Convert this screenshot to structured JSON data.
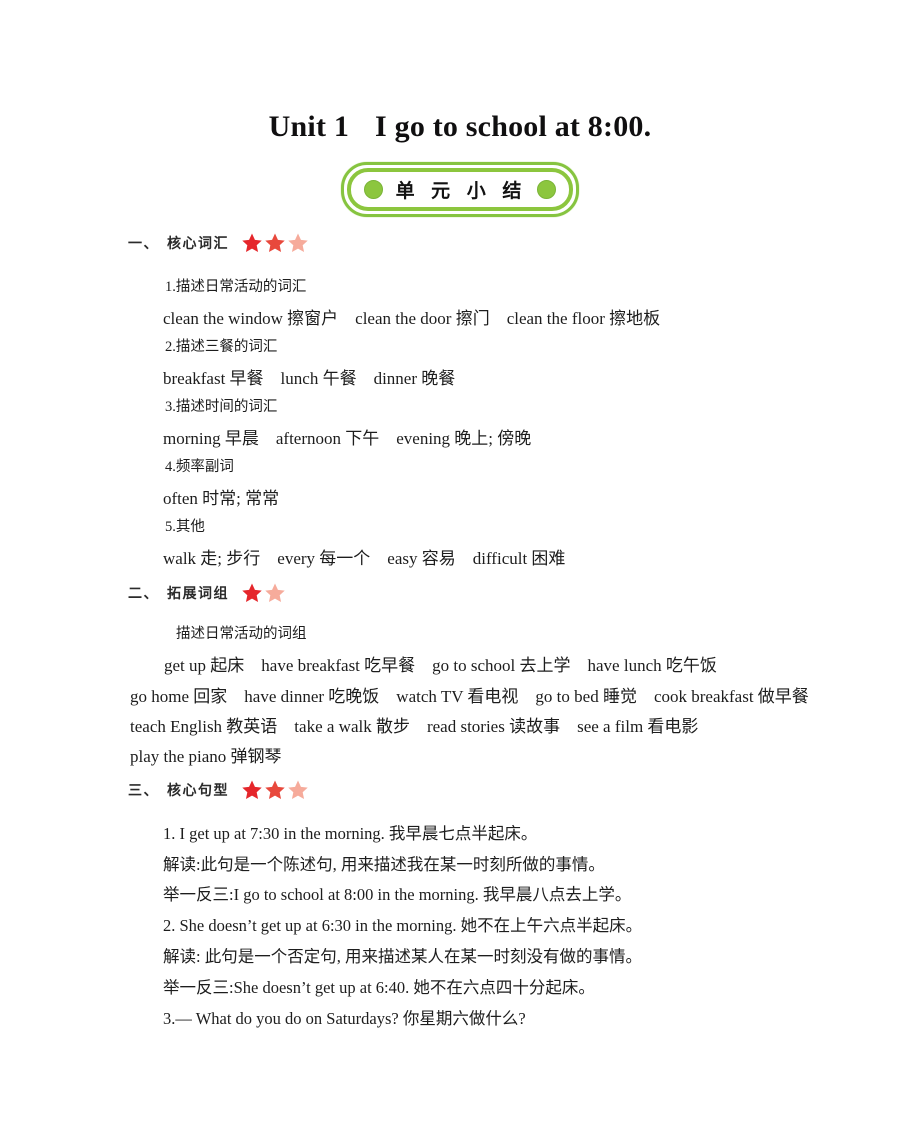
{
  "title": {
    "unit": "Unit 1",
    "sentence": "I go to school at 8:00."
  },
  "badge": {
    "label": "单 元 小 结",
    "dot_color": "#8cc63e",
    "border_color": "#8cc63e"
  },
  "colors": {
    "star_full": "#e5262b",
    "star_mid": "#e8483c",
    "star_faded": "#f6ab9b"
  },
  "sections": [
    {
      "number": "一、",
      "name": "核心词汇",
      "stars": [
        "full",
        "mid",
        "faded"
      ],
      "lines": [
        "1.描述日常活动的词汇",
        "clean the window 擦窗户    clean the door 擦门    clean the floor 擦地板",
        "2.描述三餐的词汇",
        "breakfast 早餐    lunch 午餐    dinner 晚餐",
        "3.描述时间的词汇",
        "morning 早晨    afternoon 下午    evening 晚上; 傍晚",
        "4.频率副词",
        "often 时常; 常常",
        "5.其他",
        "walk 走; 步行    every 每一个    easy 容易    difficult 困难"
      ]
    },
    {
      "number": "二、",
      "name": "拓展词组",
      "stars": [
        "full",
        "faded"
      ],
      "lines": [
        "描述日常活动的词组",
        "get up 起床    have breakfast 吃早餐    go to school 去上学    have lunch 吃午饭",
        "go home 回家    have dinner 吃晚饭    watch TV 看电视    go to bed 睡觉    cook breakfast 做早餐",
        "teach English 教英语    take a walk 散步    read stories 读故事    see a film 看电影",
        "play the piano 弹钢琴"
      ]
    },
    {
      "number": "三、",
      "name": "核心句型",
      "stars": [
        "full",
        "mid",
        "faded"
      ],
      "lines": [
        "1. I get up at 7:30 in the morning. 我早晨七点半起床。",
        "解读:此句是一个陈述句, 用来描述我在某一时刻所做的事情。",
        "举一反三:I go to school at 8:00 in the morning. 我早晨八点去上学。",
        "2. She doesn’t get up at 6:30 in the morning. 她不在上午六点半起床。",
        "解读: 此句是一个否定句, 用来描述某人在某一时刻没有做的事情。",
        "举一反三:She doesn’t get up at 6:40. 她不在六点四十分起床。",
        "3.— What do you do on Saturdays? 你星期六做什么?"
      ]
    }
  ]
}
